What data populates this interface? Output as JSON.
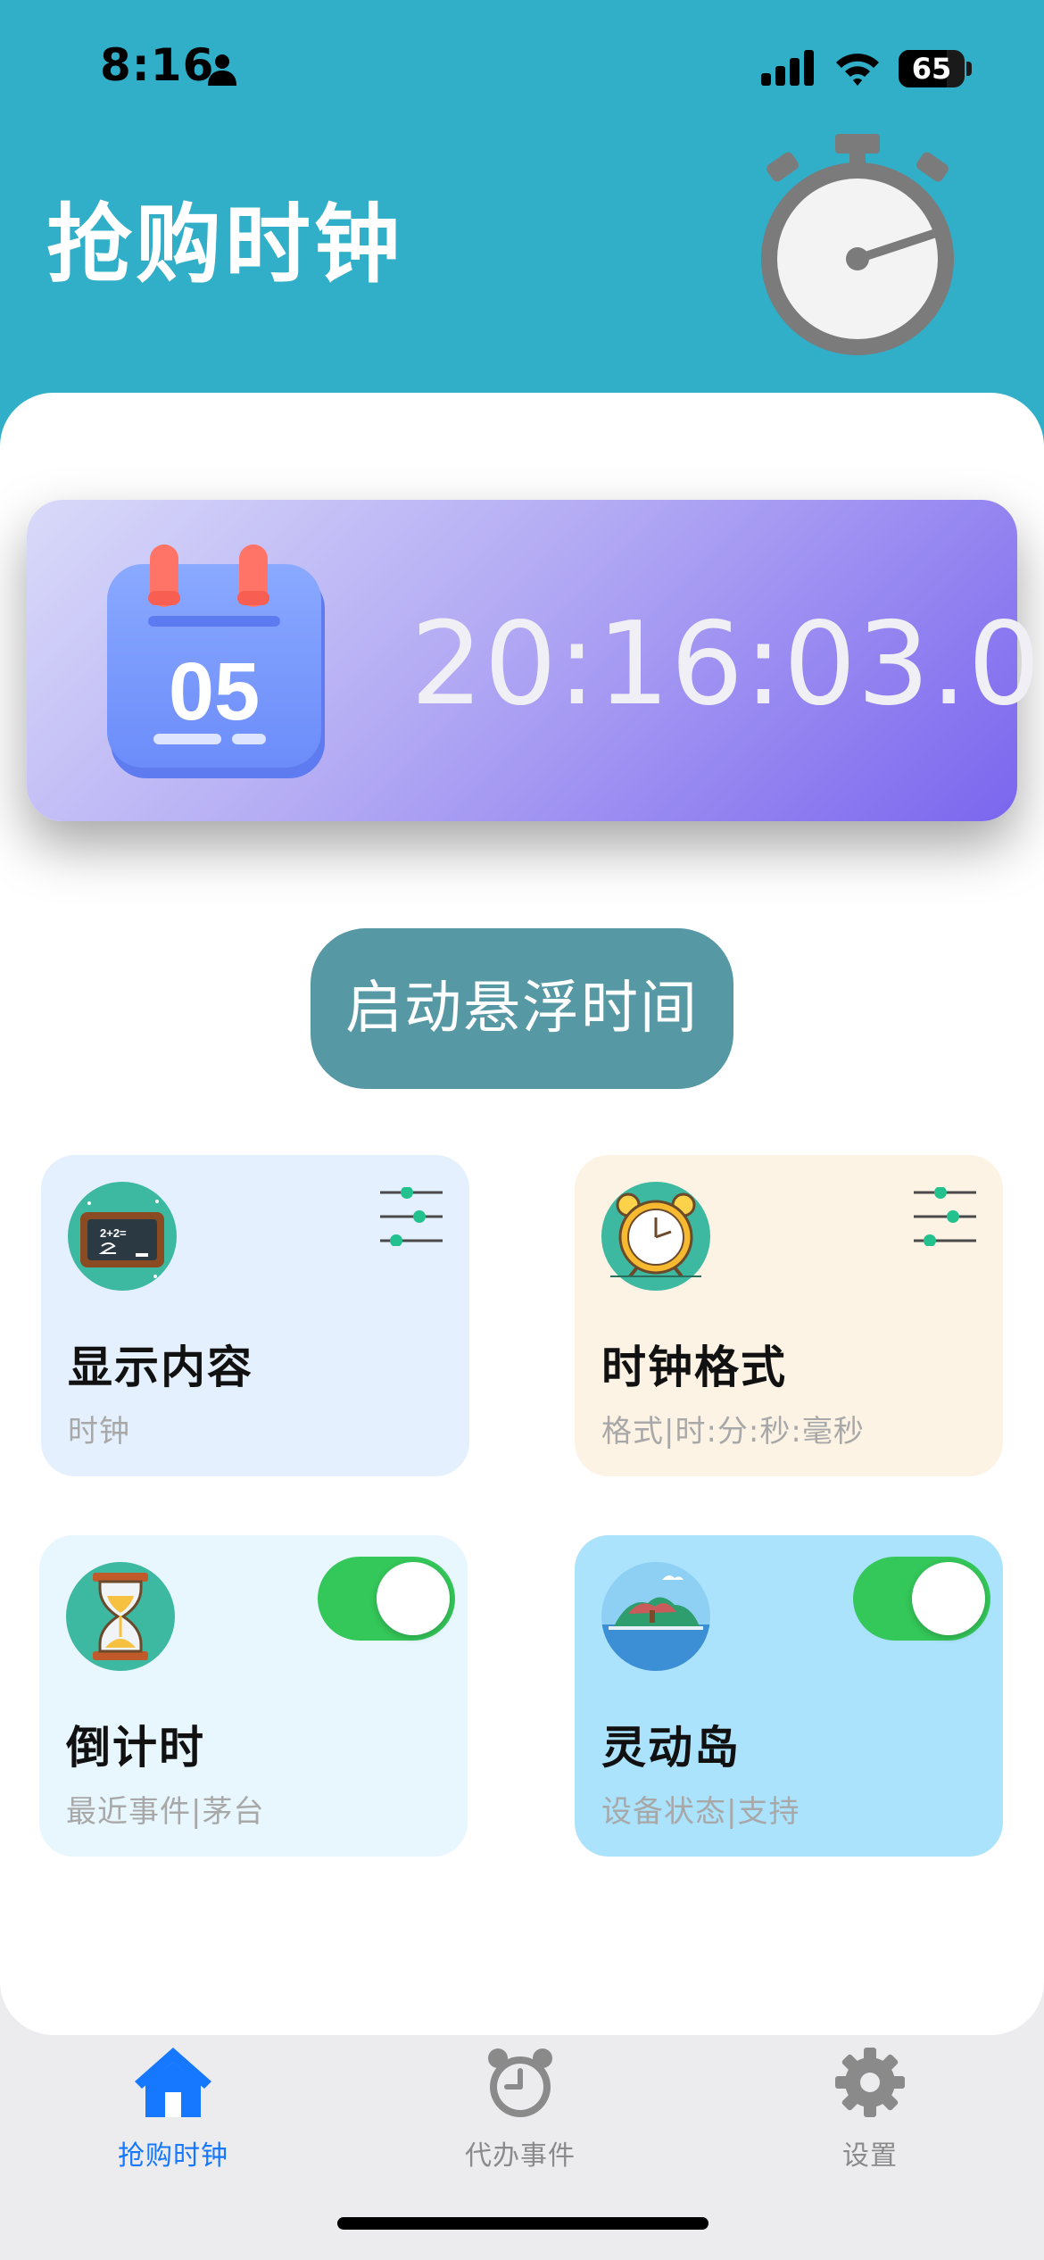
{
  "status_bar": {
    "time": "8:16",
    "battery": "65",
    "icons": [
      "person-icon",
      "signal-icon",
      "wifi-icon",
      "battery-icon"
    ]
  },
  "header": {
    "title": "抢购时钟",
    "icon": "stopwatch-icon"
  },
  "banner": {
    "calendar_day": "05",
    "time": "20:16:03.0",
    "icon": "calendar-icon"
  },
  "float_button": {
    "label": "启动悬浮时间"
  },
  "tiles": [
    {
      "title": "显示内容",
      "subtitle": "时钟",
      "icon": "blackboard-icon",
      "control": "sliders-icon",
      "bg": "#E4F0FD"
    },
    {
      "title": "时钟格式",
      "subtitle": "格式|时:分:秒:毫秒",
      "icon": "alarm-clock-icon",
      "control": "sliders-icon",
      "bg": "#FCF3E5"
    },
    {
      "title": "倒计时",
      "subtitle": "最近事件|茅台",
      "icon": "hourglass-icon",
      "control": "toggle",
      "toggle_on": true,
      "bg": "#E8F6FE"
    },
    {
      "title": "灵动岛",
      "subtitle": "设备状态|支持",
      "icon": "island-icon",
      "control": "toggle",
      "toggle_on": true,
      "bg": "#ABE2FC"
    }
  ],
  "tab_bar": {
    "active_color": "#1677FF",
    "inactive_color": "#8A8A8A",
    "items": [
      {
        "label": "抢购时钟",
        "icon": "home-icon",
        "active": true
      },
      {
        "label": "代办事件",
        "icon": "alarm-icon",
        "active": false
      },
      {
        "label": "设置",
        "icon": "gear-icon",
        "active": false
      }
    ]
  }
}
